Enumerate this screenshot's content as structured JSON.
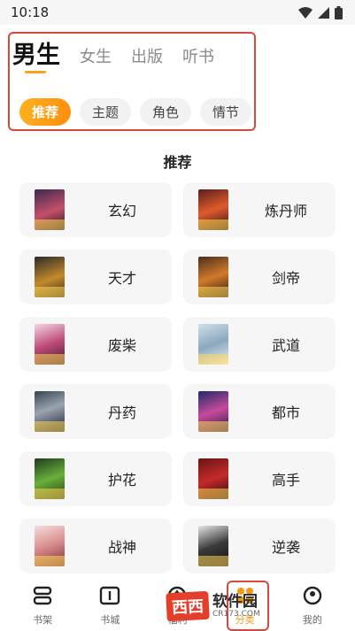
{
  "status_bar": {
    "time": "10:18"
  },
  "header": {
    "gender_tabs": [
      {
        "label": "男生",
        "active": true
      },
      {
        "label": "女生",
        "active": false
      },
      {
        "label": "出版",
        "active": false
      },
      {
        "label": "听书",
        "active": false
      }
    ],
    "filter_chips": [
      {
        "label": "推荐",
        "active": true
      },
      {
        "label": "主题",
        "active": false
      },
      {
        "label": "角色",
        "active": false
      },
      {
        "label": "情节",
        "active": false
      }
    ],
    "accent_color": "#f7a51d"
  },
  "section": {
    "title": "推荐"
  },
  "categories": [
    {
      "label": "玄幻"
    },
    {
      "label": "炼丹师"
    },
    {
      "label": "天才"
    },
    {
      "label": "剑帝"
    },
    {
      "label": "废柴"
    },
    {
      "label": "武道"
    },
    {
      "label": "丹药"
    },
    {
      "label": "都市"
    },
    {
      "label": "护花"
    },
    {
      "label": "高手"
    },
    {
      "label": "战神"
    },
    {
      "label": "逆袭"
    }
  ],
  "bottom_nav": {
    "items": [
      {
        "label": "书架",
        "icon": "bookshelf-icon"
      },
      {
        "label": "书城",
        "icon": "bookstore-icon"
      },
      {
        "label": "福利",
        "icon": "welfare-icon"
      },
      {
        "label": "分类",
        "icon": "category-icon",
        "active": true
      },
      {
        "label": "我的",
        "icon": "profile-icon"
      }
    ]
  },
  "watermark": {
    "badge": "西西",
    "text": "软件园",
    "sub": "CR173.COM"
  }
}
